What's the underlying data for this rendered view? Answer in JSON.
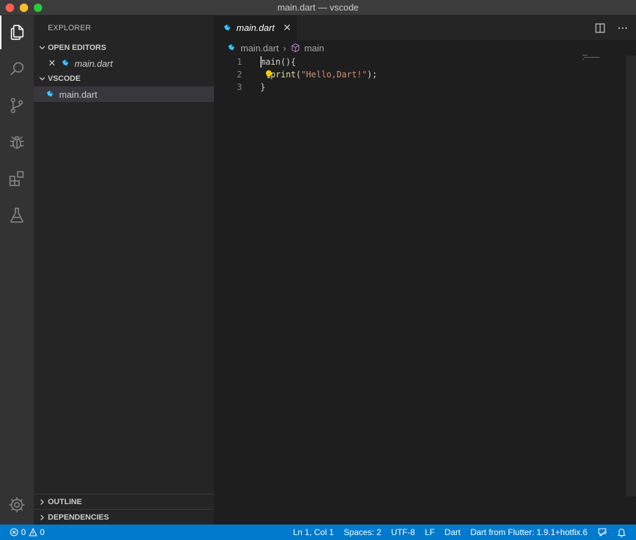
{
  "window": {
    "title": "main.dart — vscode"
  },
  "activity_bar": {
    "items": [
      {
        "icon": "files-icon",
        "active": true
      },
      {
        "icon": "search-icon",
        "active": false
      },
      {
        "icon": "source-control-icon",
        "active": false
      },
      {
        "icon": "debug-icon",
        "active": false
      },
      {
        "icon": "extensions-icon",
        "active": false
      },
      {
        "icon": "testing-flask-icon",
        "active": false
      }
    ],
    "bottom_icon": "gear-icon"
  },
  "sidebar": {
    "title": "EXPLORER",
    "open_editors": {
      "label": "OPEN EDITORS",
      "items": [
        {
          "label": "main.dart"
        }
      ]
    },
    "workspace": {
      "label": "VSCODE",
      "items": [
        {
          "label": "main.dart"
        }
      ]
    },
    "outline_label": "OUTLINE",
    "dependencies_label": "DEPENDENCIES"
  },
  "editor": {
    "tab": {
      "label": "main.dart",
      "close_glyph": "✕"
    },
    "breadcrumb": {
      "file": "main.dart",
      "symbol": "main",
      "separator": "›"
    },
    "lines": [
      {
        "number": "1",
        "text": "main(){"
      },
      {
        "number": "2",
        "prefix": "  ",
        "fn": "print",
        "open": "(",
        "string": "\"Hello,Dart!\"",
        "close": ");"
      },
      {
        "number": "3",
        "text": "}"
      }
    ]
  },
  "status_bar": {
    "errors": "0",
    "warnings": "0",
    "position": "Ln 1, Col 1",
    "spaces": "Spaces: 2",
    "encoding": "UTF-8",
    "eol": "LF",
    "language": "Dart",
    "sdk": "Dart from Flutter: 1.9.1+hotfix.6"
  },
  "colors": {
    "accent": "#007acc",
    "dart_blue": "#40c4ff",
    "dart_dark": "#0175c2",
    "symbol_purple": "#b180d7",
    "bulb_yellow": "#ffcc00"
  }
}
